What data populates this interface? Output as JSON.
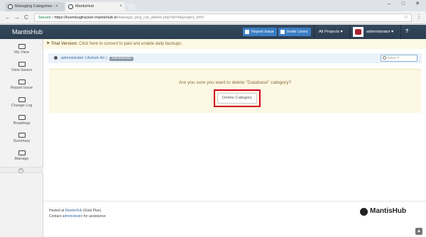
{
  "browser": {
    "tabs": [
      {
        "label": "Managing Categories - ×"
      },
      {
        "label": "MantisHub"
      }
    ],
    "tab_close": "×",
    "window_controls": {
      "minimize": "–",
      "maximize": "□",
      "close": "✕"
    },
    "nav": {
      "back": "←",
      "forward": "→",
      "reload": "C"
    },
    "address": {
      "secure_label": "Secure",
      "host": "https://learnbugtracker.mantishub.io",
      "path": "/manage_proj_cat_delete.php?id=4&project_id=0"
    },
    "star": "☆",
    "menu": "⋮"
  },
  "navbar": {
    "brand": "MantisHub",
    "report_issue": "Report Issue",
    "invite_users": "Invite Users",
    "projects": "All Projects ▾",
    "user": "administrator ▾",
    "help": "?"
  },
  "sidebar": {
    "items": [
      {
        "label": "My View",
        "icon": "dashboard-icon"
      },
      {
        "label": "View Issues",
        "icon": "list-icon"
      },
      {
        "label": "Report Issue",
        "icon": "edit-icon"
      },
      {
        "label": "Change Log",
        "icon": "retweet-icon"
      },
      {
        "label": "Roadmap",
        "icon": "road-icon"
      },
      {
        "label": "Summary",
        "icon": "bar-chart-icon"
      },
      {
        "label": "Manage",
        "icon": "gears-icon"
      }
    ],
    "collapse": "«"
  },
  "trial": {
    "label": "Trial Version:",
    "link": "Click here",
    "text": "to convert to paid and enable daily backups."
  },
  "breadcrumb": {
    "user": "administrator ( Ashish An )",
    "role": "administrator",
    "issue_placeholder": "Issue #"
  },
  "confirm": {
    "question": "Are you sure you want to delete \"Database\" category?",
    "button": "Delete Category"
  },
  "footer": {
    "hosted_prefix": "Hosted at",
    "hosted_link": "MantisHub",
    "hosted_plan": "(Gold Plan)",
    "contact_prefix": "Contact",
    "contact_link": "administrator",
    "contact_suffix": "for assistance",
    "logo": "MantisHub",
    "scroll_top": "▲"
  }
}
